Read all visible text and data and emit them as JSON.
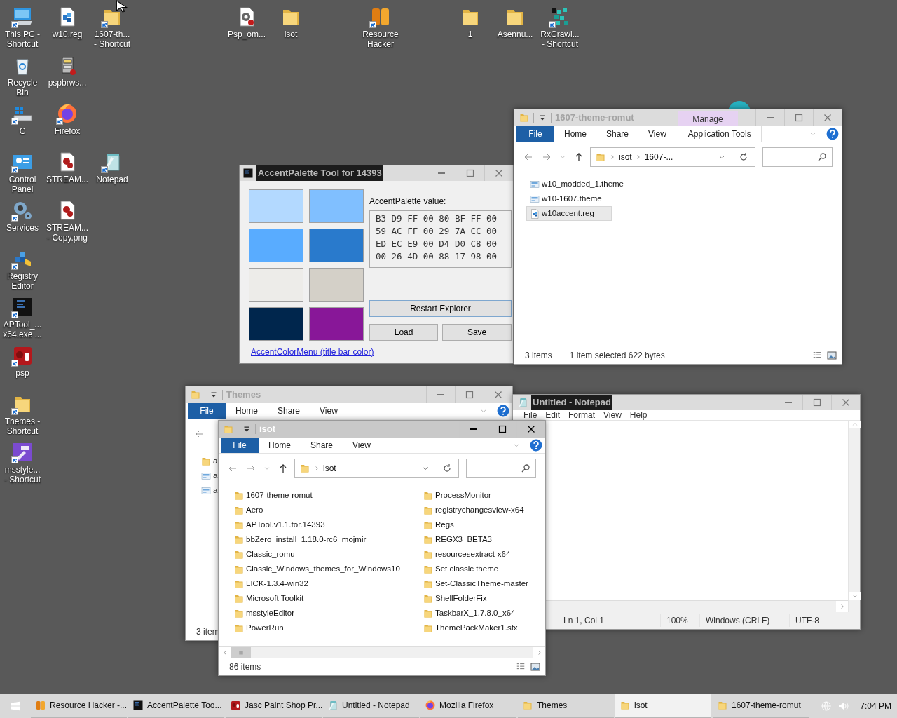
{
  "desktop_icons": [
    {
      "label": "This PC -\nShortcut",
      "kind": "pc",
      "shortcut": true
    },
    {
      "label": "w10.reg",
      "kind": "reg",
      "shortcut": false
    },
    {
      "label": "1607-th...\n- Shortcut",
      "kind": "folder",
      "shortcut": true
    },
    {
      "label": "Psp_om...",
      "kind": "pspfile",
      "shortcut": false
    },
    {
      "label": "isot",
      "kind": "folder",
      "shortcut": false
    },
    {
      "label": "Resource\nHacker",
      "kind": "rh",
      "shortcut": true
    },
    {
      "label": "1",
      "kind": "folder",
      "shortcut": false
    },
    {
      "label": "Asennu...",
      "kind": "folder",
      "shortcut": false
    },
    {
      "label": "RxCrawl...\n- Shortcut",
      "kind": "crawler",
      "shortcut": true
    },
    {
      "label": "Recycle\nBin",
      "kind": "recycle",
      "shortcut": false
    },
    {
      "label": "pspbrws...",
      "kind": "cabinet",
      "shortcut": false
    },
    {
      "label": "C",
      "kind": "drive",
      "shortcut": true
    },
    {
      "label": "Firefox",
      "kind": "firefox",
      "shortcut": true
    },
    {
      "label": "Control\nPanel",
      "kind": "control",
      "shortcut": true
    },
    {
      "label": "STREAM...",
      "kind": "pspimage",
      "shortcut": false
    },
    {
      "label": "Notepad",
      "kind": "notepad",
      "shortcut": true
    },
    {
      "label": "Services",
      "kind": "gear",
      "shortcut": true
    },
    {
      "label": "STREAM...\n- Copy.png",
      "kind": "pspimage",
      "shortcut": false
    },
    {
      "label": "Registry\nEditor",
      "kind": "regedit",
      "shortcut": true
    },
    {
      "label": "APTool_...\nx64.exe ...",
      "kind": "console",
      "shortcut": true
    },
    {
      "label": "psp",
      "kind": "psp",
      "shortcut": true
    },
    {
      "label": "Themes -\nShortcut",
      "kind": "folder",
      "shortcut": true
    },
    {
      "label": "msstyle...\n- Shortcut",
      "kind": "hammer",
      "shortcut": true
    }
  ],
  "accent_palette_window": {
    "title": "AccentPalette Tool for 14393",
    "swatches": [
      {
        "color": "#b3d9ff"
      },
      {
        "color": "#80bfff"
      },
      {
        "color": "#59acff"
      },
      {
        "color": "#297acc"
      },
      {
        "color": "#edece9"
      },
      {
        "color": "#d4d0c8"
      },
      {
        "color": "#00264d"
      },
      {
        "color": "#881798"
      }
    ],
    "value_label": "AccentPalette value:",
    "value_lines": [
      "B3 D9 FF 00 80 BF FF 00",
      "59 AC FF 00 29 7A CC 00",
      "ED EC E9 00 D4 D0 C8 00",
      "00 26 4D 00 88 17 98 00"
    ],
    "buttons": [
      "Restart Explorer",
      "Load",
      "Save"
    ],
    "link": "AccentColorMenu (title bar color)"
  },
  "explorer_windows": [
    {
      "title": "1607-theme-romut",
      "active": false,
      "file_menu": "File",
      "tabs": [
        "Home",
        "Share",
        "View"
      ],
      "contextual": {
        "group": "Manage",
        "tabs": [
          "Application Tools"
        ]
      },
      "path": [
        "isot",
        "1607-..."
      ],
      "items": [
        {
          "name": "w10_modded_1.theme",
          "kind": "theme",
          "selected": false
        },
        {
          "name": "w10-1607.theme",
          "kind": "theme",
          "selected": false
        },
        {
          "name": "w10accent.reg",
          "kind": "reg",
          "selected": true
        }
      ],
      "status": [
        "3 items",
        "1 item selected  622 bytes"
      ]
    },
    {
      "title": "Themes",
      "active": false,
      "file_menu": "File",
      "tabs": [
        "Home",
        "Share",
        "View"
      ],
      "items": [
        {
          "name": "a",
          "kind": "folder",
          "selected": false
        },
        {
          "name": "a",
          "kind": "theme",
          "selected": false
        },
        {
          "name": "a",
          "kind": "theme",
          "selected": false
        }
      ],
      "status": [
        "3 item"
      ]
    },
    {
      "title": "isot",
      "active": true,
      "file_menu": "File",
      "tabs": [
        "Home",
        "Share",
        "View"
      ],
      "path": [
        "isot"
      ],
      "items": [
        {
          "name": "1607-theme-romut",
          "kind": "folder",
          "selected": false
        },
        {
          "name": "Aero",
          "kind": "folder",
          "selected": false
        },
        {
          "name": "APTool.v1.1.for.14393",
          "kind": "folder",
          "selected": false
        },
        {
          "name": "bbZero_install_1.18.0-rc6_mojmir",
          "kind": "folder",
          "selected": false
        },
        {
          "name": "Classic_romu",
          "kind": "folder",
          "selected": false
        },
        {
          "name": "Classic_Windows_themes_for_Windows10",
          "kind": "folder",
          "selected": false
        },
        {
          "name": "LICK-1.3.4-win32",
          "kind": "folder",
          "selected": false
        },
        {
          "name": "Microsoft Toolkit",
          "kind": "folder",
          "selected": false
        },
        {
          "name": "msstyleEditor",
          "kind": "folder",
          "selected": false
        },
        {
          "name": "PowerRun",
          "kind": "folder",
          "selected": false
        },
        {
          "name": "ProcessMonitor",
          "kind": "folder",
          "selected": false
        },
        {
          "name": "registrychangesview-x64",
          "kind": "folder",
          "selected": false
        },
        {
          "name": "Regs",
          "kind": "folder",
          "selected": false
        },
        {
          "name": "REGX3_BETA3",
          "kind": "folder",
          "selected": false
        },
        {
          "name": "resourcesextract-x64",
          "kind": "folder",
          "selected": false
        },
        {
          "name": "Set classic theme",
          "kind": "folder",
          "selected": false
        },
        {
          "name": "Set-ClassicTheme-master",
          "kind": "folder",
          "selected": false
        },
        {
          "name": "ShellFolderFix",
          "kind": "folder",
          "selected": false
        },
        {
          "name": "TaskbarX_1.7.8.0_x64",
          "kind": "folder",
          "selected": false
        },
        {
          "name": "ThemePackMaker1.sfx",
          "kind": "folder",
          "selected": false
        }
      ],
      "status": [
        "86 items"
      ]
    }
  ],
  "notepad_window": {
    "title": "Untitled - Notepad",
    "menu": [
      "File",
      "Edit",
      "Format",
      "View",
      "Help"
    ],
    "status": [
      "Ln 1, Col 1",
      "100%",
      "Windows (CRLF)",
      "UTF-8"
    ]
  },
  "taskbar": {
    "items": [
      {
        "label": "Resource Hacker -...",
        "kind": "rh",
        "selected": false
      },
      {
        "label": "AccentPalette Too...",
        "kind": "console",
        "selected": false
      },
      {
        "label": "Jasc Paint Shop Pr...",
        "kind": "psp",
        "selected": false
      },
      {
        "label": "Untitled - Notepad",
        "kind": "notepad",
        "selected": false
      },
      {
        "label": "Mozilla Firefox",
        "kind": "firefox",
        "selected": false
      },
      {
        "label": "Themes",
        "kind": "folder",
        "selected": false
      },
      {
        "label": "isot",
        "kind": "folder",
        "selected": true
      },
      {
        "label": "1607-theme-romut",
        "kind": "folder",
        "selected": false
      }
    ],
    "clock": "7:04 PM"
  }
}
